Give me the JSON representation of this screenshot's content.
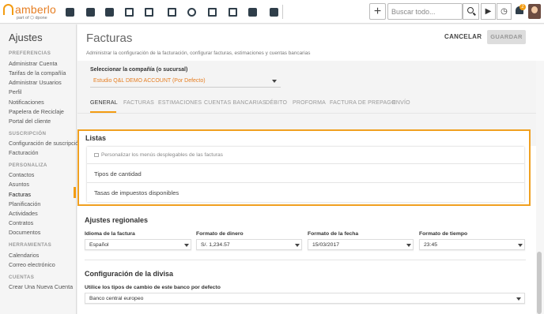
{
  "app": {
    "logo_text": "amberlo",
    "logo_sub": "part of ⬡ dpone"
  },
  "topbar": {
    "icons": [
      "dashboard-icon",
      "contacts-icon",
      "briefcase-icon",
      "billing-icon",
      "documents-icon",
      "calendar-icon",
      "history-icon",
      "folder-icon",
      "file-search-icon",
      "mail-icon",
      "reports-icon"
    ],
    "add_label": "+",
    "search_placeholder": "Buscar todo...",
    "play_label": "▶",
    "timer_label": "◷",
    "notification_count": "2",
    "accent": "#f39c12"
  },
  "sidebar": {
    "title": "Ajustes",
    "sections": [
      {
        "label": "PREFERENCIAS",
        "items": [
          "Administrar Cuenta",
          "Tarifas de la compañía",
          "Administrar Usuarios",
          "Perfil",
          "Notificaciones",
          "Papelera de Reciclaje",
          "Portal del cliente"
        ]
      },
      {
        "label": "SUSCRIPCIÓN",
        "items": [
          "Configuración de suscripción",
          "Facturación"
        ]
      },
      {
        "label": "PERSONALIZA",
        "items": [
          "Contactos",
          "Asuntos",
          "Facturas",
          "Planificación",
          "Actividades",
          "Contratos",
          "Documentos"
        ]
      },
      {
        "label": "HERRAMIENTAS",
        "items": [
          "Calendarios",
          "Correo electrónico"
        ]
      },
      {
        "label": "CUENTAS",
        "items": [
          "Crear Una Nueva Cuenta"
        ]
      }
    ],
    "active_item": "Facturas"
  },
  "page": {
    "title": "Facturas",
    "description": "Administrar la configuración de la facturación, configurar facturas, estimaciones y cuentas bancarias",
    "cancel_label": "CANCELAR",
    "save_label": "GUARDAR",
    "company_label": "Seleccionar la compañía (o sucursal)",
    "company_value": "Estudio Q&L DEMO ACCOUNT (Por Defecto)",
    "tabs": [
      "GENERAL",
      "FACTURAS",
      "ESTIMACIONES",
      "CUENTAS BANCARIAS",
      "DÉBITO",
      "PROFORMA",
      "FACTURA DE PREPAGO",
      "ENVÍO"
    ],
    "active_tab": "GENERAL"
  },
  "listas": {
    "title": "Listas",
    "hint": "Personalizar los menús desplegables de las facturas",
    "rows": [
      "Tipos de cantidad",
      "Tasas de impuestos disponibles"
    ],
    "highlight_color": "#f0a020"
  },
  "regional": {
    "title": "Ajustes regionales",
    "fields": [
      {
        "label": "Idioma de la factura",
        "value": "Español"
      },
      {
        "label": "Formato de dinero",
        "value": "S/. 1,234.57"
      },
      {
        "label": "Formato de la fecha",
        "value": "15/03/2017"
      },
      {
        "label": "Formato de tiempo",
        "value": "23:45"
      }
    ]
  },
  "currency": {
    "title": "Configuración de la divisa",
    "label": "Utilice los tipos de cambio de este banco por defecto",
    "value": "Banco central europeo"
  }
}
